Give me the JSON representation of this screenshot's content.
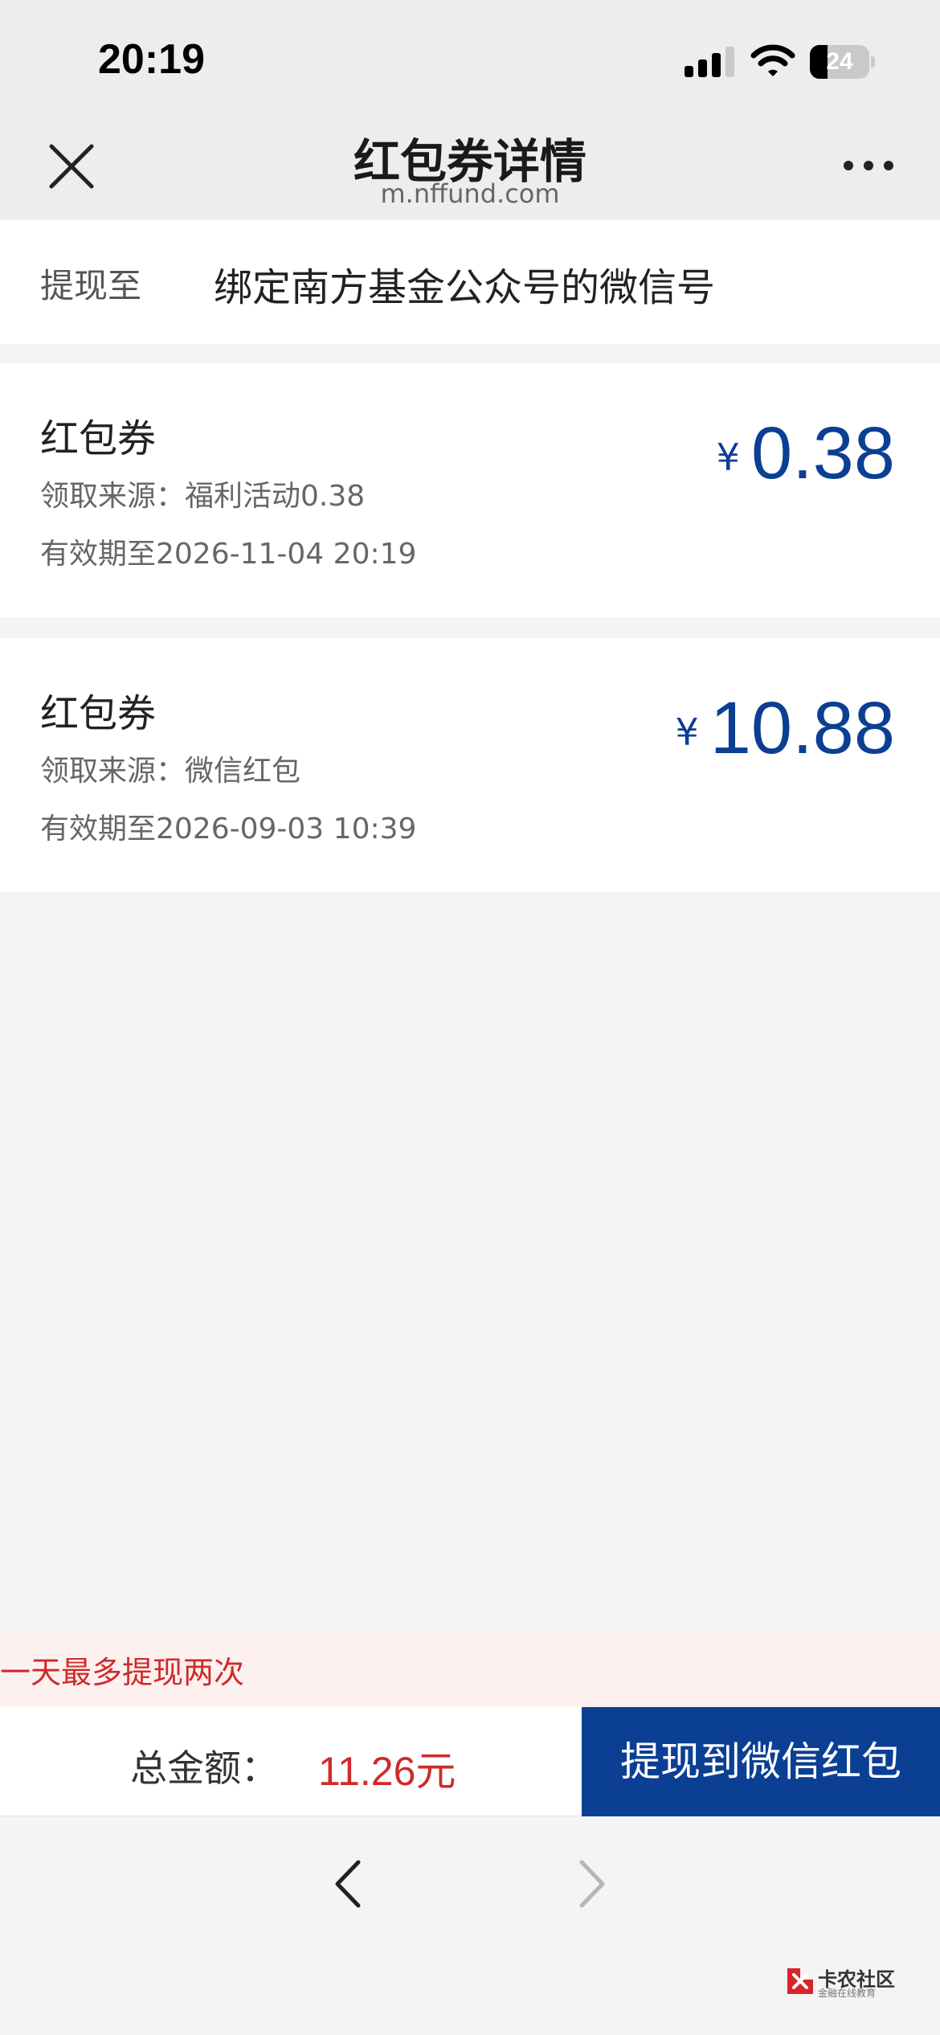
{
  "status_bar": {
    "time": "20:19",
    "battery": "24"
  },
  "nav": {
    "title": "红包券详情",
    "domain": "m.nffund.com",
    "close_icon": "close-icon",
    "more_icon": "more-icon"
  },
  "withdraw": {
    "label": "提现至",
    "value": "绑定南方基金公众号的微信号"
  },
  "coupons": [
    {
      "title": "红包券",
      "source": "领取来源：福利活动0.38",
      "expiry": "有效期至2026-11-04 20:19",
      "currency": "¥",
      "amount": "0.38"
    },
    {
      "title": "红包券",
      "source": "领取来源：微信红包",
      "expiry": "有效期至2026-09-03 10:39",
      "currency": "¥",
      "amount": "10.88"
    }
  ],
  "notice": "一天最多提现两次",
  "footer": {
    "total_label": "总金额：",
    "total_value": "11.26元",
    "button_label": "提现到微信红包"
  },
  "browser": {
    "back_icon": "chevron-left-icon",
    "forward_icon": "chevron-right-icon"
  },
  "watermark": {
    "name": "卡农社区",
    "sub": "金融在线教育"
  },
  "colors": {
    "accent": "#0b3f93",
    "alert": "#cf2a2a",
    "notice_bg": "#fdf1f0"
  }
}
